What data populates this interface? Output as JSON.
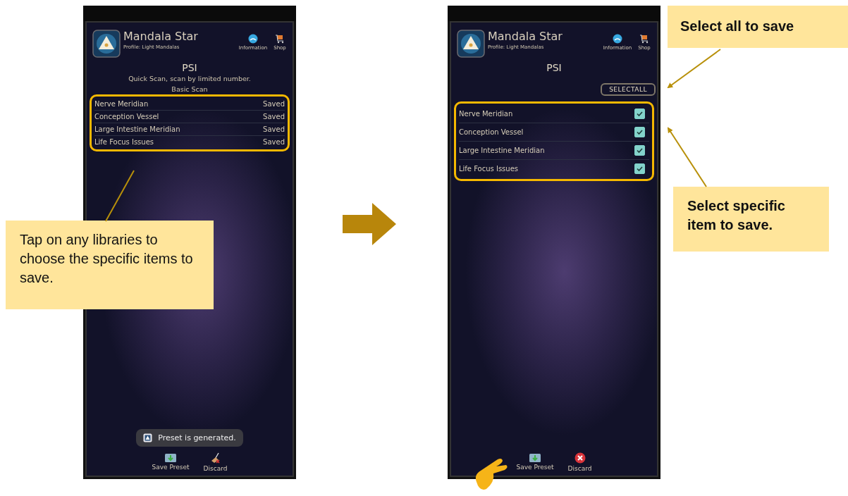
{
  "screens": [
    {
      "kind": "libraries",
      "app": {
        "title": "Mandala Star",
        "profile": "Profile: Light Mandalas"
      },
      "header_actions": [
        {
          "kind": "info",
          "label": "Information"
        },
        {
          "kind": "shop",
          "label": "Shop"
        }
      ],
      "heading": "PSI",
      "description_lines": [
        "Quick Scan, scan by limited number.",
        "Basic Scan"
      ],
      "libraries": [
        {
          "name": "Nerve Meridian",
          "status": "Saved"
        },
        {
          "name": "Conception Vessel",
          "status": "Saved"
        },
        {
          "name": "Large Intestine Meridian",
          "status": "Saved"
        },
        {
          "name": "Life Focus Issues",
          "status": "Saved"
        }
      ],
      "toast": "Preset is generated.",
      "bottom_actions": [
        {
          "kind": "save",
          "label": "Save Preset"
        },
        {
          "kind": "discard",
          "label": "Discard"
        }
      ]
    },
    {
      "kind": "selection",
      "app": {
        "title": "Mandala Star",
        "profile": "Profile: Light Mandalas"
      },
      "header_actions": [
        {
          "kind": "info",
          "label": "Information"
        },
        {
          "kind": "shop",
          "label": "Shop"
        }
      ],
      "heading": "PSI",
      "select_all": "SELECTALL",
      "items": [
        {
          "name": "Nerve Meridian",
          "checked": true
        },
        {
          "name": "Conception Vessel",
          "checked": true
        },
        {
          "name": "Large Intestine Meridian",
          "checked": true
        },
        {
          "name": "Life Focus Issues",
          "checked": true
        }
      ],
      "bottom_actions": [
        {
          "kind": "save",
          "label": "Save Preset"
        },
        {
          "kind": "discard",
          "label": "Discard"
        }
      ]
    }
  ],
  "callouts": [
    {
      "text": "Tap on any libraries to choose the specific items to save."
    },
    {
      "text": "Select all to save"
    },
    {
      "text": "Select specific item to save."
    }
  ]
}
